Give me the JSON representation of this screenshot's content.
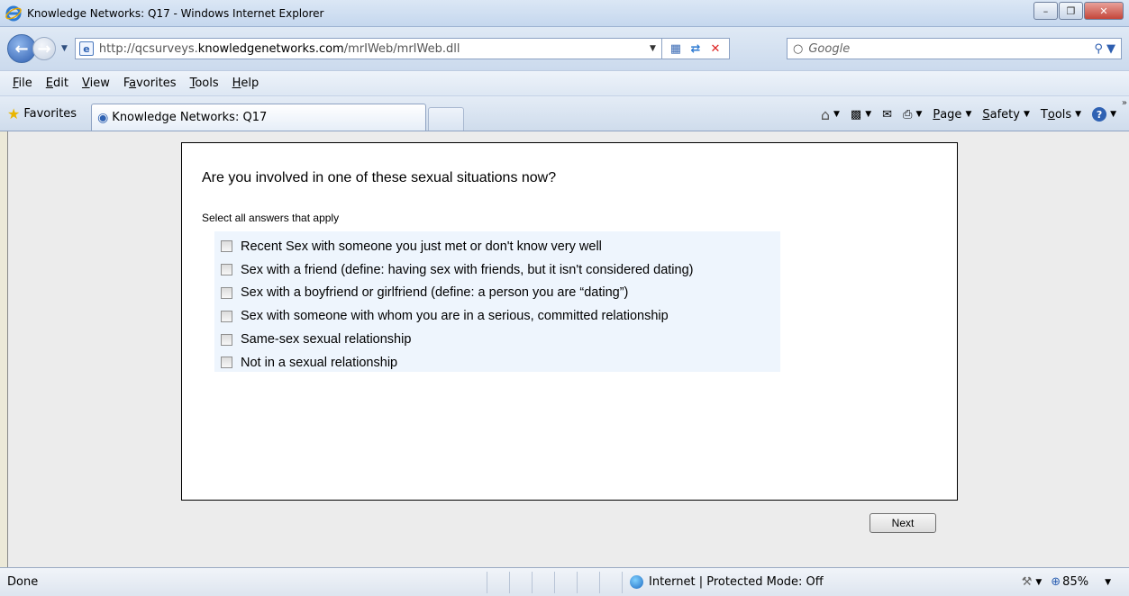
{
  "window": {
    "title": "Knowledge Networks: Q17 - Windows Internet Explorer",
    "buttons": {
      "minimize": "–",
      "maximize": "❐",
      "close": "✕"
    }
  },
  "address": {
    "url_prefix": "http://qcsurveys.",
    "url_domain": "knowledgenetworks.com",
    "url_path": "/mrIWeb/mrIWeb.dll",
    "search_placeholder": "Google"
  },
  "menu": {
    "items": [
      {
        "key": "F",
        "rest": "ile"
      },
      {
        "key": "E",
        "rest": "dit"
      },
      {
        "key": "V",
        "rest": "iew"
      },
      {
        "pre": "F",
        "key": "a",
        "rest": "vorites"
      },
      {
        "key": "T",
        "rest": "ools"
      },
      {
        "key": "H",
        "rest": "elp"
      }
    ]
  },
  "favorites": {
    "label": "Favorites",
    "tab_title": "Knowledge Networks: Q17",
    "commands": [
      {
        "key": "P",
        "rest": "age"
      },
      {
        "key": "S",
        "rest": "afety"
      },
      {
        "pre": "T",
        "key": "o",
        "rest": "ols"
      }
    ]
  },
  "survey": {
    "question": "Are you involved in one of these sexual situations now?",
    "instruction": "Select all answers that apply",
    "options": [
      "Recent Sex with someone you just met or don't know very well",
      "Sex with a friend (define: having sex with friends, but it isn't considered dating)",
      "Sex with a boyfriend or girlfriend (define: a person you are “dating”)",
      "Sex with someone with whom you are in a serious, committed relationship",
      "Same-sex sexual relationship",
      "Not in a sexual relationship"
    ],
    "next_label": "Next"
  },
  "status": {
    "text": "Done",
    "zone": "Internet | Protected Mode: Off",
    "zoom": "85%"
  },
  "icons": [
    "ie-logo-icon",
    "back-icon",
    "forward-icon",
    "search-icon",
    "favorites-star-icon",
    "home-icon",
    "feeds-icon",
    "mail-icon",
    "print-icon",
    "help-icon",
    "globe-icon",
    "zoom-icon"
  ],
  "colors": {
    "options_background": "#eef5fd",
    "content_background": "#ececec"
  }
}
